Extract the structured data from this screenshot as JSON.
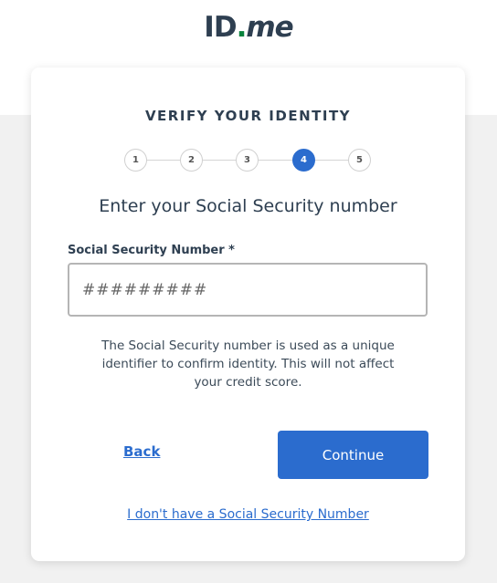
{
  "logo": {
    "id": "ID",
    "dot": ".",
    "me": "me"
  },
  "card": {
    "heading": "VERIFY YOUR IDENTITY",
    "steps": [
      {
        "label": "1",
        "active": false
      },
      {
        "label": "2",
        "active": false
      },
      {
        "label": "3",
        "active": false
      },
      {
        "label": "4",
        "active": true
      },
      {
        "label": "5",
        "active": false
      }
    ],
    "title": "Enter your Social Security number",
    "ssn_field": {
      "label": "Social Security Number *",
      "value": "",
      "placeholder": "#########"
    },
    "help_text": "The Social Security number is used as a unique identifier to confirm identity. This will not affect your credit score.",
    "back_label": "Back",
    "continue_label": "Continue",
    "no_ssn_label": "I don't have a Social Security Number"
  },
  "colors": {
    "primary": "#2b6cce",
    "text": "#2e3f51",
    "logo_dot": "#08833d",
    "page_background": "#f1f1f1"
  }
}
